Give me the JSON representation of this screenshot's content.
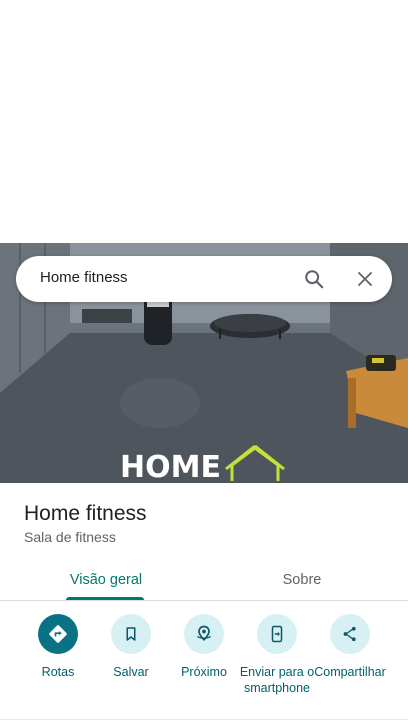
{
  "search": {
    "query": "Home fitness"
  },
  "photo": {
    "logo_text": "HOME"
  },
  "place": {
    "name": "Home fitness",
    "category": "Sala de fitness"
  },
  "tabs": [
    {
      "label": "Visão geral",
      "selected": true
    },
    {
      "label": "Sobre",
      "selected": false
    }
  ],
  "actions": [
    {
      "label": "Rotas",
      "icon": "directions-icon"
    },
    {
      "label": "Salvar",
      "icon": "bookmark-icon"
    },
    {
      "label": "Próximo",
      "icon": "nearby-icon"
    },
    {
      "label": "Enviar para o smartphone",
      "icon": "send-to-phone-icon"
    },
    {
      "label": "Compartilhar",
      "icon": "share-icon"
    }
  ],
  "colors": {
    "accent": "#00796b",
    "primary_action": "#0b7285",
    "action_bg": "#d7f0f4"
  }
}
